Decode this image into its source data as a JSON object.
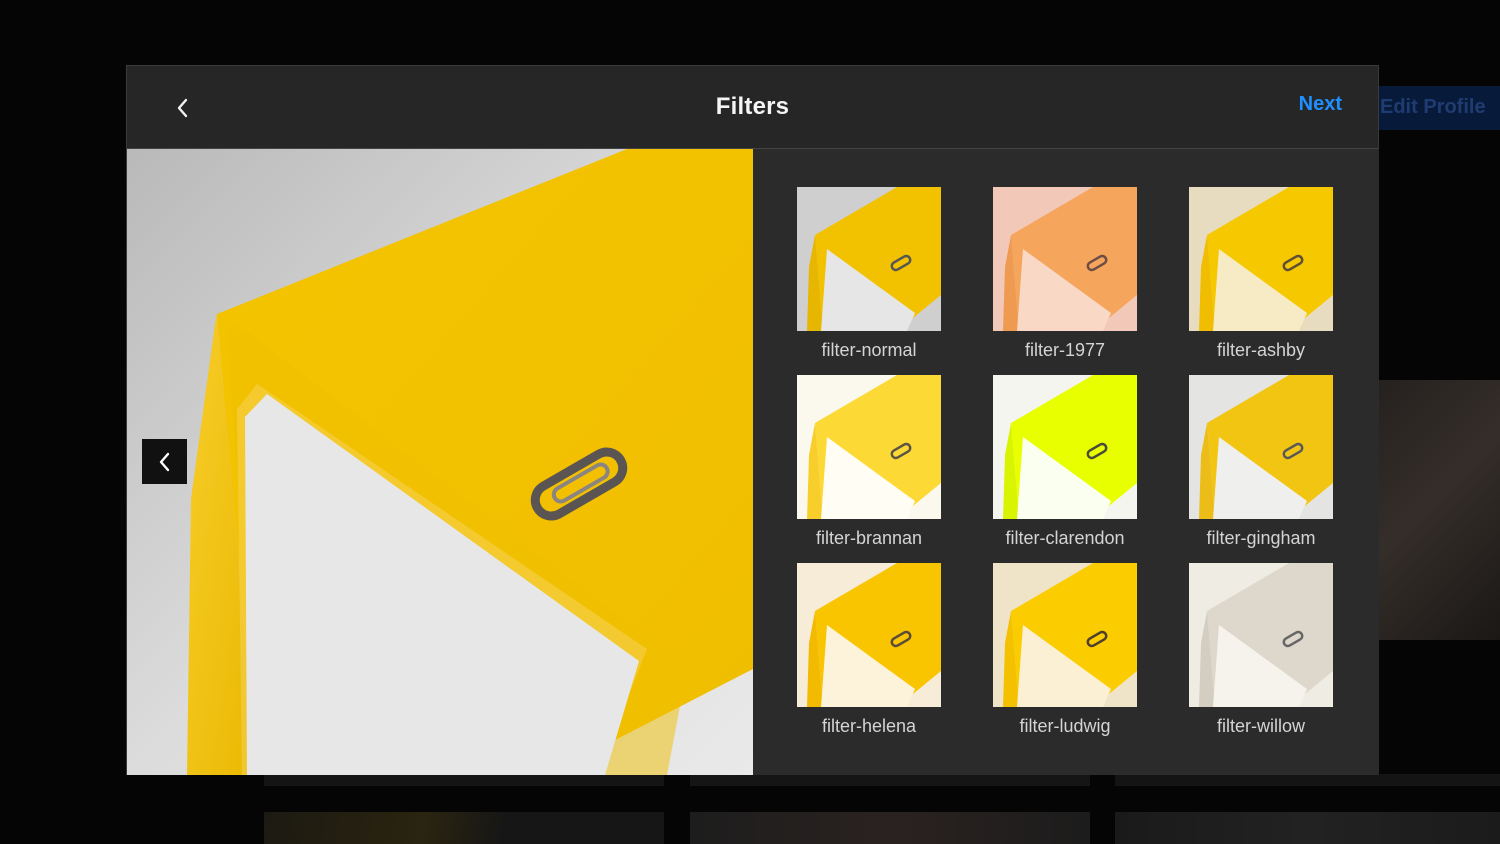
{
  "background": {
    "edit_profile_label": "Edit Profile"
  },
  "header": {
    "title": "Filters",
    "next_label": "Next",
    "back_icon": "chevron-left-icon"
  },
  "preview": {
    "prev_icon": "chevron-left-icon"
  },
  "colors": {
    "accent": "#1e90ff",
    "modal_bg": "#262626",
    "panel_bg": "#2b2b2b"
  },
  "filters": [
    {
      "label": "filter-normal"
    },
    {
      "label": "filter-1977"
    },
    {
      "label": "filter-ashby"
    },
    {
      "label": "filter-brannan"
    },
    {
      "label": "filter-clarendon"
    },
    {
      "label": "filter-gingham"
    },
    {
      "label": "filter-helena"
    },
    {
      "label": "filter-ludwig"
    },
    {
      "label": "filter-willow"
    }
  ]
}
